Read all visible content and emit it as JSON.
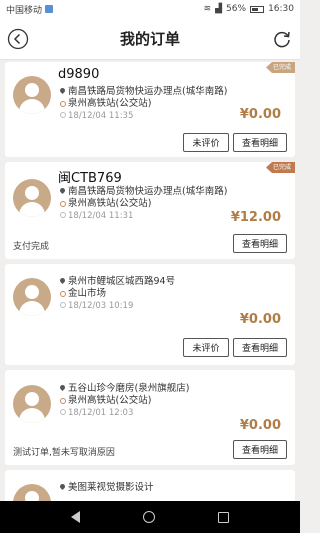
{
  "status_bar": {
    "carrier": "中国移动",
    "battery": "56%",
    "time": "16:30"
  },
  "header": {
    "title": "我的订单"
  },
  "orders": [
    {
      "plate": "d9890",
      "from": "南昌铁路局货物快运办理点(城华南路)",
      "to": "泉州高铁站(公交站)",
      "time": "18/12/04 11:35",
      "price": "¥0.00",
      "tag": "已完成",
      "rate_label": "未评价",
      "detail_label": "查看明细"
    },
    {
      "plate": "闽CTB769",
      "from": "南昌铁路局货物快运办理点(城华南路)",
      "to": "泉州高铁站(公交站)",
      "time": "18/12/04 11:31",
      "price": "¥12.00",
      "tag": "已完成",
      "note": "支付完成",
      "detail_label": "查看明细"
    },
    {
      "from": "泉州市鲤城区城西路94号",
      "to": "金山市场",
      "time": "18/12/03 10:19",
      "price": "¥0.00",
      "rate_label": "未评价",
      "detail_label": "查看明细"
    },
    {
      "from": "五谷山珍今磨房(泉州旗舰店)",
      "to": "泉州高铁站(公交站)",
      "time": "18/12/01 12:03",
      "price": "¥0.00",
      "note": "测试订单,暂未写取消原因",
      "detail_label": "查看明细"
    },
    {
      "from": "美图莱视觉摄影设计"
    }
  ]
}
